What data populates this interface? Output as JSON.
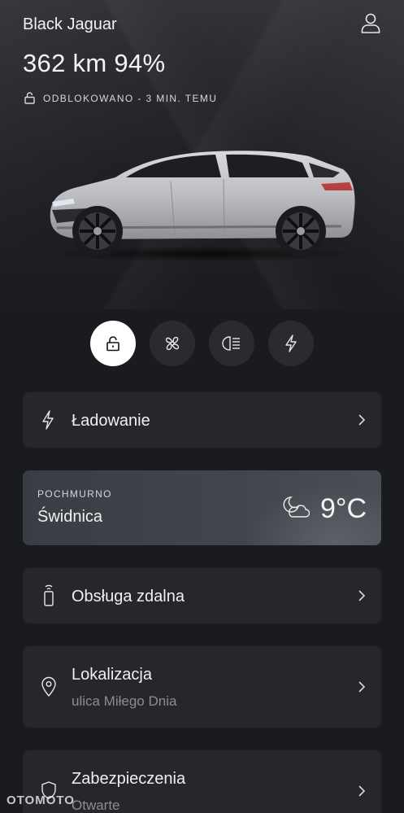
{
  "header": {
    "car_name": "Black Jaguar",
    "range": "362 km 94%",
    "lock_status": "ODBLOKOWANO - 3 MIN. TEMU"
  },
  "controls": [
    {
      "name": "lock",
      "icon": "unlocked-padlock-icon",
      "active": true
    },
    {
      "name": "climate",
      "icon": "fan-icon",
      "active": false
    },
    {
      "name": "lights",
      "icon": "headlight-icon",
      "active": false
    },
    {
      "name": "charging",
      "icon": "lightning-icon",
      "active": false
    }
  ],
  "cards": {
    "charging": {
      "title": "Ładowanie"
    },
    "weather": {
      "condition": "POCHMURNO",
      "city": "Świdnica",
      "temperature": "9°C"
    },
    "remote": {
      "title": "Obsługa zdalna"
    },
    "location": {
      "title": "Lokalizacja",
      "subtitle": "ulica Miłego Dnia"
    },
    "security": {
      "title": "Zabezpieczenia",
      "subtitle": "Otwarte"
    }
  },
  "watermark": "OTOMOTO",
  "colors": {
    "background": "#1a1b1e",
    "card": "#26272b",
    "active_control": "#ffffff"
  }
}
